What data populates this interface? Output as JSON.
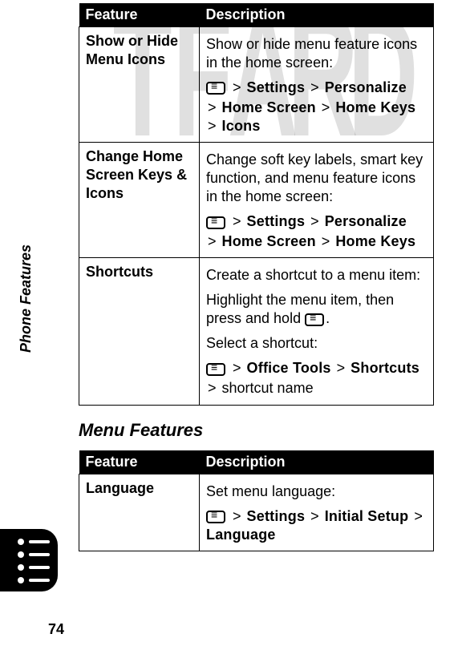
{
  "sideLabel": "Phone Features",
  "pageNumber": "74",
  "table1": {
    "headFeature": "Feature",
    "headDesc": "Description",
    "rows": [
      {
        "feature": "Show or Hide Menu Icons",
        "desc1": "Show or hide menu feature icons in the home screen:",
        "path1a": "Settings",
        "path1b": "Personalize",
        "path2a": "Home Screen",
        "path2b": "Home Keys",
        "path2c": "Icons"
      },
      {
        "feature": "Change Home Screen Keys & Icons",
        "desc1": "Change soft key labels, smart key function, and menu feature icons in the home screen:",
        "path1a": "Settings",
        "path1b": "Personalize",
        "path2a": "Home Screen",
        "path2b": "Home Keys"
      },
      {
        "feature": "Shortcuts",
        "desc1": "Create a shortcut to a menu item:",
        "desc2a": "Highlight the menu item, then press and hold ",
        "desc2b": ".",
        "desc3": "Select a shortcut:",
        "path1a": "Office Tools",
        "path1b": "Shortcuts",
        "path2plain": "shortcut name"
      }
    ]
  },
  "sectionTitle": "Menu Features",
  "table2": {
    "headFeature": "Feature",
    "headDesc": "Description",
    "rows": [
      {
        "feature": "Language",
        "desc1": "Set menu language:",
        "path1a": "Settings",
        "path1b": "Initial Setup",
        "path1c": "Language"
      }
    ]
  },
  "gt": ">"
}
